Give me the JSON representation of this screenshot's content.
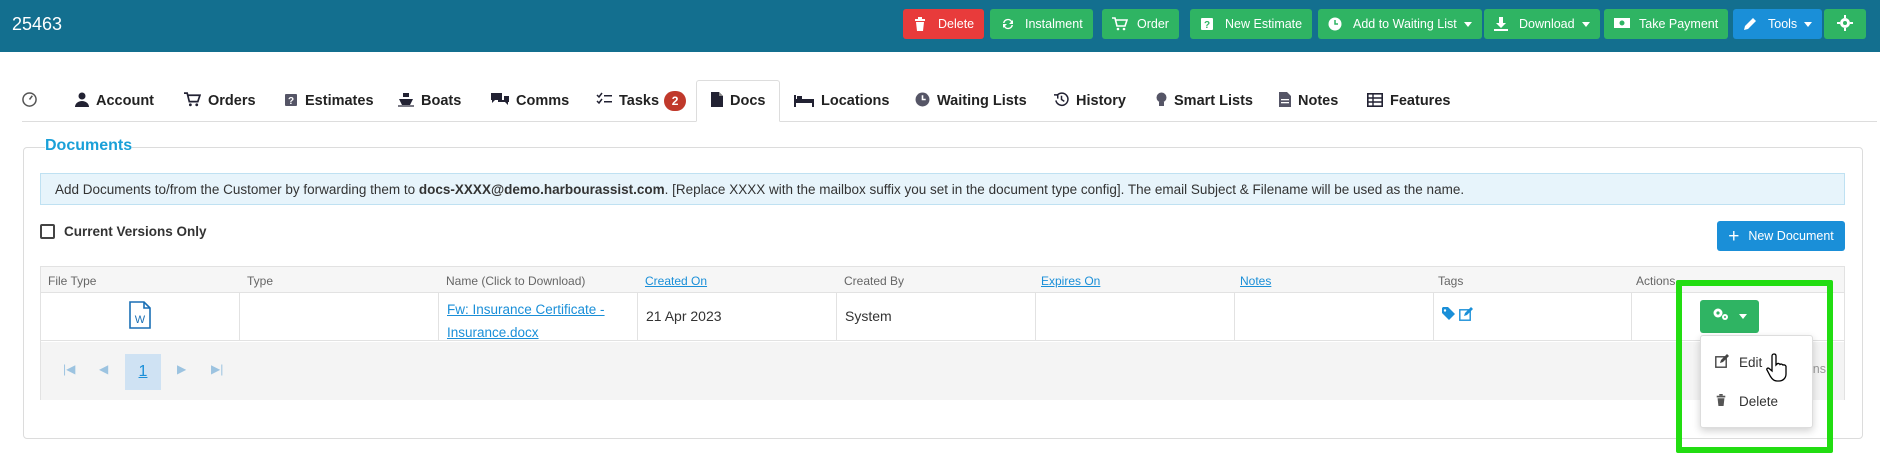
{
  "header": {
    "record_id": "25463",
    "buttons": [
      {
        "label": "Delete",
        "icon": "trash-icon",
        "color": "#e83b3b"
      },
      {
        "label": "Instalment",
        "icon": "refresh-icon",
        "color": "#2fb463"
      },
      {
        "label": "Order",
        "icon": "cart-icon",
        "color": "#2fb463"
      },
      {
        "label": "New Estimate",
        "icon": "question-icon",
        "color": "#2fb463"
      },
      {
        "label": "Add to Waiting List",
        "icon": "clock-icon",
        "color": "#2fb463",
        "dropdown": true
      },
      {
        "label": "Download",
        "icon": "download-icon",
        "color": "#2fb463",
        "dropdown": true
      },
      {
        "label": "Take Payment",
        "icon": "money-icon",
        "color": "#2fb463"
      },
      {
        "label": "Tools",
        "icon": "pencil-icon",
        "color": "#1a8fd8",
        "dropdown": true
      }
    ]
  },
  "tabs": [
    {
      "label": "",
      "icon": "dashboard-icon"
    },
    {
      "label": "Account",
      "icon": "user-icon"
    },
    {
      "label": "Orders",
      "icon": "cart-icon"
    },
    {
      "label": "Estimates",
      "icon": "question-icon"
    },
    {
      "label": "Boats",
      "icon": "ship-icon"
    },
    {
      "label": "Comms",
      "icon": "comments-icon"
    },
    {
      "label": "Tasks",
      "icon": "tasks-icon",
      "badge": "2"
    },
    {
      "label": "Docs",
      "icon": "file-icon",
      "active": true
    },
    {
      "label": "Locations",
      "icon": "bed-icon"
    },
    {
      "label": "Waiting Lists",
      "icon": "clock-icon"
    },
    {
      "label": "History",
      "icon": "history-icon"
    },
    {
      "label": "Smart Lists",
      "icon": "lightbulb-icon"
    },
    {
      "label": "Notes",
      "icon": "note-icon"
    },
    {
      "label": "Features",
      "icon": "table-icon"
    }
  ],
  "documents": {
    "title": "Documents",
    "info_prefix": "Add Documents to/from the Customer by forwarding them to ",
    "info_email": "docs-XXXX@demo.harbourassist.com",
    "info_suffix": ". [Replace XXXX with the mailbox suffix you set in the document type config]. The email Subject & Filename will be used as the name.",
    "current_versions_label": "Current Versions Only",
    "new_document_label": "New Document",
    "columns": [
      "File Type",
      "Type",
      "Name (Click to Download)",
      "Created On",
      "Created By",
      "Expires On",
      "Notes",
      "Tags",
      "Actions"
    ],
    "rows": [
      {
        "file_type_icon": "word-file-icon",
        "type": "",
        "name": "Fw: Insurance Certificate - Insurance.docx",
        "created_on": "21 Apr 2023",
        "created_by": "System",
        "expires_on": "",
        "notes": ""
      }
    ],
    "pagination": {
      "current_page": "1",
      "items_info_fragment": "ns"
    }
  },
  "actions_menu": {
    "items": [
      {
        "label": "Edit",
        "icon": "edit-icon"
      },
      {
        "label": "Delete",
        "icon": "trash-icon"
      }
    ]
  }
}
